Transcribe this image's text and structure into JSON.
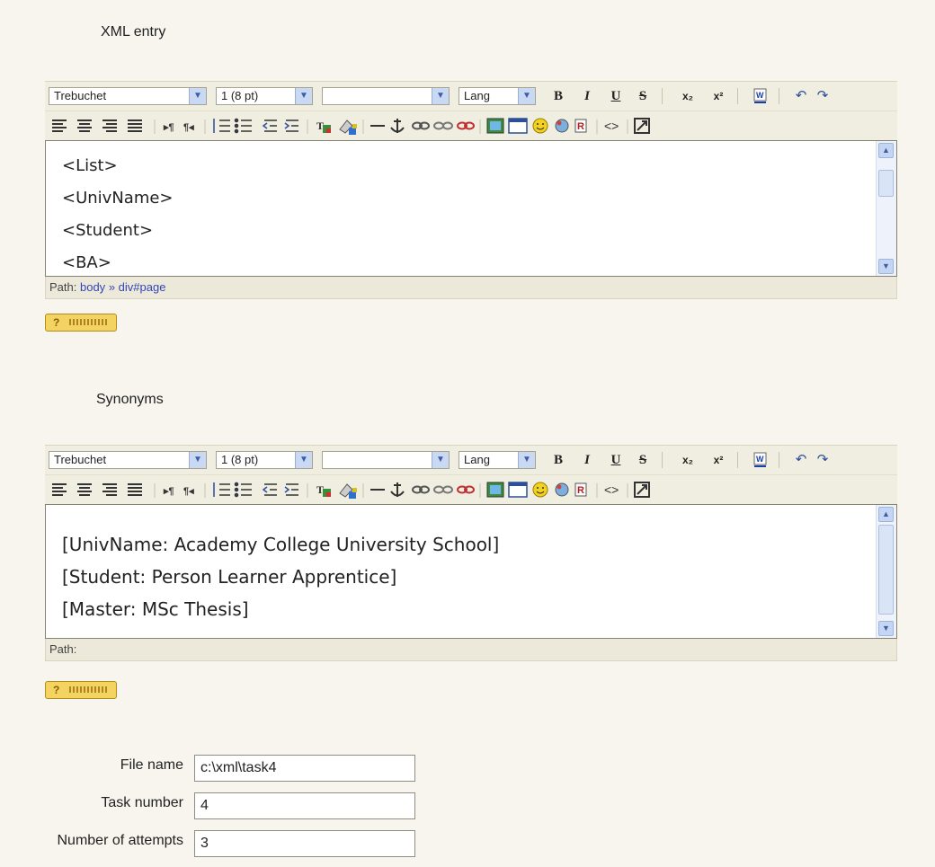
{
  "xml": {
    "label": "XML entry",
    "toolbar": {
      "font": "Trebuchet",
      "size": "1 (8 pt)",
      "style": "",
      "lang": "Lang"
    },
    "lines": [
      "<List>",
      "<UnivName>",
      "<Student>",
      "<BA>"
    ],
    "path": {
      "label": "Path:",
      "parts": [
        "body",
        "»",
        "div#page"
      ]
    }
  },
  "synonyms": {
    "label": "Synonyms",
    "toolbar": {
      "font": "Trebuchet",
      "size": "1 (8 pt)",
      "style": "",
      "lang": "Lang"
    },
    "lines": [
      "[UnivName: Academy College University School]",
      "[Student: Person Learner Apprentice]",
      "[Master: MSc Thesis]"
    ],
    "path": {
      "label": "Path:"
    }
  },
  "help_label": "?",
  "icons": {
    "bold": "B",
    "italic": "I",
    "underline": "U",
    "strike": "S",
    "subscript": "x₂",
    "superscript": "x²"
  },
  "fields": [
    {
      "label": "File name",
      "value": "c:\\xml\\task4"
    },
    {
      "label": "Task number",
      "value": "4"
    },
    {
      "label": "Number of attempts",
      "value": "3"
    }
  ],
  "colors": {
    "toolbar_bg": "#f0ede1",
    "path_link": "#3246b5",
    "help_bg": "#f3d462",
    "scrollbar": "#c5d6f4"
  }
}
